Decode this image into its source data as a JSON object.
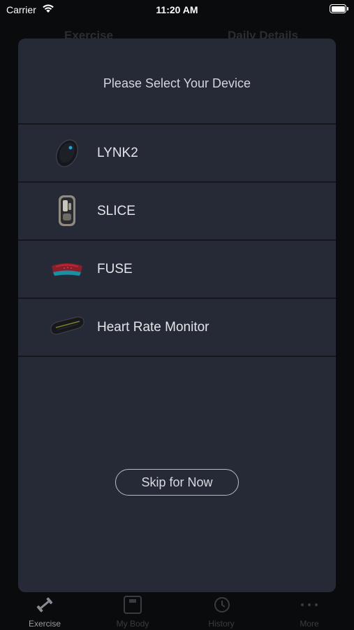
{
  "status_bar": {
    "carrier": "Carrier",
    "time": "11:20 AM"
  },
  "background": {
    "header_left": "Exercise",
    "header_right": "Daily Details"
  },
  "modal": {
    "title": "Please Select Your Device",
    "devices": [
      {
        "name": "LYNK2",
        "icon": "lynk2-device-icon"
      },
      {
        "name": "SLICE",
        "icon": "slice-device-icon"
      },
      {
        "name": "FUSE",
        "icon": "fuse-device-icon"
      },
      {
        "name": "Heart Rate Monitor",
        "icon": "heart-rate-monitor-icon"
      }
    ],
    "skip_label": "Skip for Now"
  },
  "tabbar": {
    "items": [
      {
        "label": "Exercise",
        "icon": "dumbbell-icon",
        "active": true
      },
      {
        "label": "My Body",
        "icon": "scale-icon",
        "active": false
      },
      {
        "label": "History",
        "icon": "history-icon",
        "active": false
      },
      {
        "label": "More",
        "icon": "more-dots-icon",
        "active": false
      }
    ]
  },
  "colors": {
    "modal_bg": "#262936",
    "divider": "#15171d",
    "text": "#e3e5ea",
    "fuse_accent": "#c0283a",
    "lynk_accent": "#1aa3d6"
  }
}
